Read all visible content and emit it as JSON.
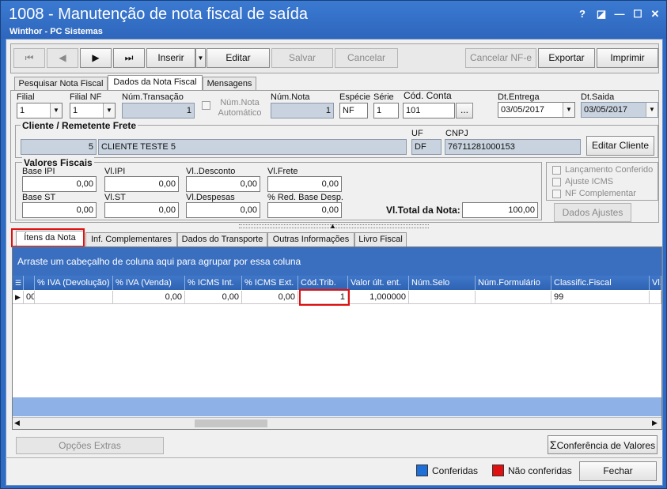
{
  "window": {
    "title": "1008 - Manutenção de nota fiscal de saída",
    "subtitle": "Winthor - PC Sistemas",
    "help": "?",
    "restore": "◪",
    "minimize": "—",
    "maximize": "☐",
    "close": "✕"
  },
  "toolbar": {
    "first": "⏮",
    "prev": "◀",
    "next": "▶",
    "last": "⏭",
    "insert": "Inserir",
    "edit": "Editar",
    "save": "Salvar",
    "cancel": "Cancelar",
    "cancel_nfe": "Cancelar NF-e",
    "export": "Exportar",
    "print": "Imprimir"
  },
  "tabs": {
    "search": "Pesquisar Nota Fiscal",
    "data": "Dados da Nota Fiscal",
    "messages": "Mensagens"
  },
  "fields": {
    "filial": {
      "label": "Filial",
      "value": "1"
    },
    "filial_nf": {
      "label": "Filial NF",
      "value": "1"
    },
    "num_transacao": {
      "label": "Núm.Transação",
      "value": "1"
    },
    "num_nota_auto": {
      "label": "Núm.Nota Automático"
    },
    "num_nota": {
      "label": "Núm.Nota",
      "value": "1"
    },
    "especie": {
      "label": "Espécie",
      "value": "NF"
    },
    "serie": {
      "label": "Série",
      "value": "1"
    },
    "cod_conta": {
      "label": "Cód. Conta",
      "value": "101",
      "button": "..."
    },
    "dt_entrega": {
      "label": "Dt.Entrega",
      "value": "03/05/2017"
    },
    "dt_saida": {
      "label": "Dt.Saida",
      "value": "03/05/2017"
    }
  },
  "client": {
    "group": "Cliente / Remetente Frete",
    "code": "5",
    "name": "CLIENTE TESTE 5",
    "uf_label": "UF",
    "uf": "DF",
    "cnpj_label": "CNPJ",
    "cnpj": "76711281000153",
    "edit_button": "Editar Cliente"
  },
  "fiscal": {
    "group": "Valores Fiscais",
    "base_ipi": {
      "label": "Base IPI",
      "value": "0,00"
    },
    "vl_ipi": {
      "label": "Vl.IPI",
      "value": "0,00"
    },
    "vl_desconto": {
      "label": "Vl..Desconto",
      "value": "0,00"
    },
    "vl_frete": {
      "label": "Vl.Frete",
      "value": "0,00"
    },
    "base_st": {
      "label": "Base ST",
      "value": "0,00"
    },
    "vl_st": {
      "label": "Vl.ST",
      "value": "0,00"
    },
    "vl_despesas": {
      "label": "Vl.Despesas",
      "value": "0,00"
    },
    "red_base": {
      "label": "% Red. Base Desp.",
      "value": "0,00"
    },
    "total": {
      "label": "Vl.Total da Nota:",
      "value": "100,00"
    }
  },
  "options": {
    "lancamento": "Lançamento Conferido",
    "ajuste": "Ajuste ICMS",
    "nf_compl": "NF Complementar",
    "dados_ajustes": "Dados Ajustes"
  },
  "subtabs": {
    "itens": "Ítens da Nota",
    "inf": "Inf. Complementares",
    "transporte": "Dados do Transporte",
    "outras": "Outras Informações",
    "livro": "Livro Fiscal"
  },
  "grid": {
    "group_hint": "Arraste um cabeçalho de coluna aqui para agrupar por essa coluna",
    "columns": [
      "% IVA (Devolução)",
      "% IVA (Venda)",
      "% ICMS Int.",
      "% ICMS Ext.",
      "Cód.Trib.",
      "Valor últ. ent.",
      "Núm.Selo",
      "Núm.Formulário",
      "Classific.Fiscal",
      "Vl."
    ],
    "row": [
      "00",
      "",
      "0,00",
      "0,00",
      "0,00",
      "1",
      "1,000000",
      "",
      "",
      "99",
      ""
    ]
  },
  "bottom": {
    "opcoes": "Opções Extras",
    "conferencia": "Conferência de Valores",
    "conferidas": "Conferidas",
    "nao_conferidas": "Não conferidas",
    "fechar": "Fechar"
  },
  "colors": {
    "conferidas": "#1e6fd8",
    "nao_conferidas": "#e01010"
  }
}
